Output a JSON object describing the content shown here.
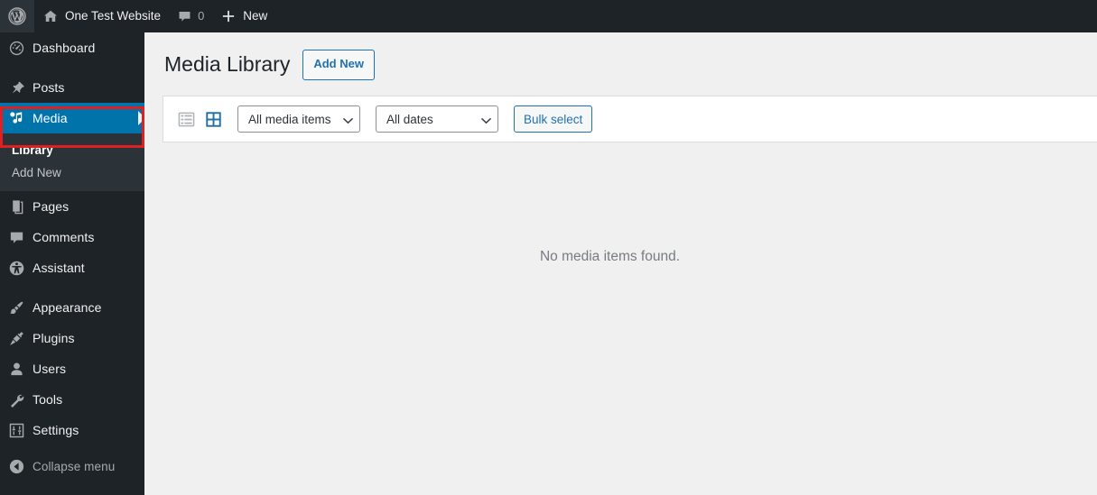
{
  "admin_bar": {
    "wp_logo": {
      "icon": "wordpress-logo-icon",
      "label": ""
    },
    "site": {
      "icon": "home-icon",
      "label": "One Test Website"
    },
    "comments": {
      "icon": "comment-bubble-icon",
      "count": "0"
    },
    "new": {
      "icon": "plus-icon",
      "label": "New"
    }
  },
  "sidebar": {
    "items": [
      {
        "label": "Dashboard",
        "icon": "dashboard-gauge-icon",
        "current": false
      },
      {
        "label": "Posts",
        "icon": "pushpin-icon",
        "current": false
      },
      {
        "label": "Media",
        "icon": "media-music-note-icon",
        "current": true
      },
      {
        "label": "Pages",
        "icon": "pages-icon",
        "current": false
      },
      {
        "label": "Comments",
        "icon": "comment-bubble-icon",
        "current": false
      },
      {
        "label": "Assistant",
        "icon": "accessibility-icon",
        "current": false
      },
      {
        "label": "Appearance",
        "icon": "paintbrush-icon",
        "current": false
      },
      {
        "label": "Plugins",
        "icon": "plug-icon",
        "current": false
      },
      {
        "label": "Users",
        "icon": "user-icon",
        "current": false
      },
      {
        "label": "Tools",
        "icon": "wrench-icon",
        "current": false
      },
      {
        "label": "Settings",
        "icon": "sliders-icon",
        "current": false
      }
    ],
    "media_submenu": [
      {
        "label": "Library",
        "current": true
      },
      {
        "label": "Add New",
        "current": false
      }
    ],
    "collapse": {
      "label": "Collapse menu",
      "icon": "collapse-left-arrow-icon"
    },
    "highlight_target": "Media",
    "highlight_color": "#e02020",
    "current_bg_color": "#0073aa"
  },
  "main": {
    "page_title": "Media Library",
    "add_new_label": "Add New",
    "toolbar": {
      "list_view": {
        "icon": "list-view-icon",
        "active": false
      },
      "grid_view": {
        "icon": "grid-view-icon",
        "active": true
      },
      "media_filter": {
        "value": "All media items",
        "icon": "chevron-down-icon"
      },
      "date_filter": {
        "value": "All dates",
        "icon": "chevron-down-icon"
      },
      "bulk_select_label": "Bulk select"
    },
    "empty_message": "No media items found."
  }
}
